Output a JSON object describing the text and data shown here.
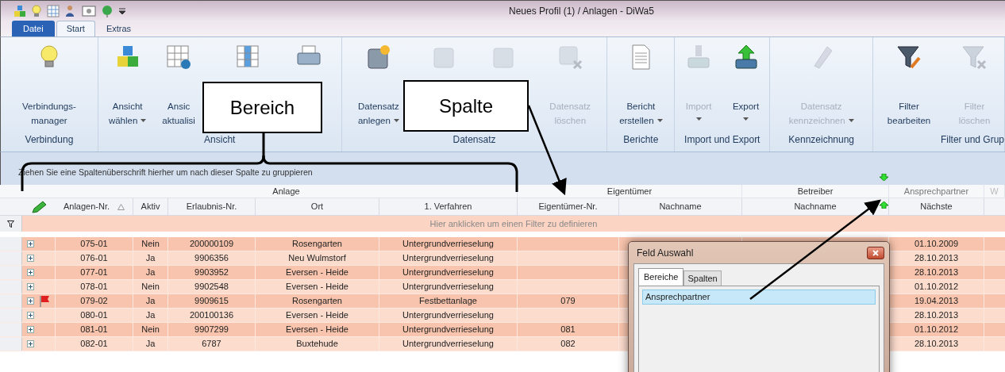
{
  "window": {
    "title": "Neues Profil (1) / Anlagen - DiWa5"
  },
  "tabs": [
    {
      "label": "Datei",
      "kind": "backstage",
      "selected": false
    },
    {
      "label": "Start",
      "kind": "tab",
      "selected": true
    },
    {
      "label": "Extras",
      "kind": "tab",
      "selected": false
    }
  ],
  "ribbon_groups": [
    {
      "label": "Verbindung",
      "buttons": [
        {
          "lines": [
            "Verbindungs-",
            "manager"
          ],
          "dropdown": false,
          "disabled": false
        }
      ]
    },
    {
      "label": "Ansicht",
      "buttons": [
        {
          "lines": [
            "Ansicht",
            "wählen"
          ],
          "dropdown": true,
          "disabled": false
        },
        {
          "lines": [
            "Ansic",
            "aktualisi"
          ],
          "dropdown": false,
          "disabled": false
        },
        {
          "disabled": false
        },
        {
          "disabled": false
        }
      ]
    },
    {
      "label": "Datensatz",
      "buttons": [
        {
          "lines": [
            "Datensatz",
            "anlegen"
          ],
          "dropdown": true,
          "disabled": false
        },
        {
          "disabled": true
        },
        {
          "disabled": true
        },
        {
          "lines": [
            "Datensatz",
            "löschen"
          ],
          "dropdown": false,
          "disabled": true
        }
      ]
    },
    {
      "label": "Berichte",
      "buttons": [
        {
          "lines": [
            "Bericht",
            "erstellen"
          ],
          "dropdown": true,
          "disabled": false
        }
      ]
    },
    {
      "label": "Import und Export",
      "buttons": [
        {
          "lines": [
            "Import"
          ],
          "dropdown": true,
          "disabled": true
        },
        {
          "lines": [
            "Export"
          ],
          "dropdown": true,
          "disabled": false
        }
      ]
    },
    {
      "label": "Kennzeichnung",
      "buttons": [
        {
          "lines": [
            "Datensatz",
            "kennzeichnen"
          ],
          "dropdown": true,
          "disabled": true
        }
      ]
    },
    {
      "label": "Filter und Grup",
      "buttons": [
        {
          "lines": [
            "Filter",
            "bearbeiten"
          ],
          "dropdown": false,
          "disabled": false
        },
        {
          "lines": [
            "Filter",
            "löschen"
          ],
          "dropdown": false,
          "disabled": true
        }
      ]
    }
  ],
  "annotations": [
    {
      "kind": "callout",
      "text": "Bereich"
    },
    {
      "kind": "callout",
      "text": "Spalte"
    }
  ],
  "group_panel": {
    "hint": "Ziehen Sie eine Spaltenüberschrift hierher um nach dieser Spalte zu gruppieren"
  },
  "bands": [
    {
      "label": "Anlage"
    },
    {
      "label": "Eigentümer"
    },
    {
      "label": "Betreiber"
    },
    {
      "label": "Ansprechpartner"
    },
    {
      "label": "W"
    }
  ],
  "columns": [
    {
      "label": "Anlagen-Nr.",
      "sorted": true
    },
    {
      "label": "Aktiv",
      "sorted": false
    },
    {
      "label": "Erlaubnis-Nr.",
      "sorted": false
    },
    {
      "label": "Ort",
      "sorted": false
    },
    {
      "label": "1. Verfahren",
      "sorted": false
    },
    {
      "label": "Eigentümer-Nr.",
      "sorted": false
    },
    {
      "label": "Nachname",
      "sorted": false
    },
    {
      "label": "Nachname",
      "sorted": false
    },
    {
      "label": "Nächste",
      "sorted": false
    }
  ],
  "filter_row": {
    "text": "Hier anklicken um einen Filter zu definieren"
  },
  "rows": [
    {
      "anlagen_nr": "075-01",
      "aktiv": "Nein",
      "erlaubnis_nr": "200000109",
      "ort": "Rosengarten",
      "verfahren": "Untergrundverrieselung",
      "naechste": "01.10.2009",
      "flagged": false
    },
    {
      "anlagen_nr": "076-01",
      "aktiv": "Ja",
      "erlaubnis_nr": "9906356",
      "ort": "Neu Wulmstorf",
      "verfahren": "Untergrundverrieselung",
      "naechste": "28.10.2013",
      "flagged": false
    },
    {
      "anlagen_nr": "077-01",
      "aktiv": "Ja",
      "erlaubnis_nr": "9903952",
      "ort": "Eversen - Heide",
      "verfahren": "Untergrundverrieselung",
      "naechste": "28.10.2013",
      "flagged": false
    },
    {
      "anlagen_nr": "078-01",
      "aktiv": "Nein",
      "erlaubnis_nr": "9902548",
      "ort": "Eversen - Heide",
      "verfahren": "Untergrundverrieselung",
      "naechste": "01.10.2012",
      "flagged": false
    },
    {
      "anlagen_nr": "079-02",
      "aktiv": "Ja",
      "erlaubnis_nr": "9909615",
      "ort": "Rosengarten",
      "verfahren": "Festbettanlage",
      "eigentuemer_nr": "079",
      "naechste": "19.04.2013",
      "flagged": true
    },
    {
      "anlagen_nr": "080-01",
      "aktiv": "Ja",
      "erlaubnis_nr": "200100136",
      "ort": "Eversen - Heide",
      "verfahren": "Untergrundverrieselung",
      "naechste": "28.10.2013",
      "flagged": false
    },
    {
      "anlagen_nr": "081-01",
      "aktiv": "Nein",
      "erlaubnis_nr": "9907299",
      "ort": "Eversen - Heide",
      "verfahren": "Untergrundverrieselung",
      "eigentuemer_nr": "081",
      "naechste": "01.10.2012",
      "flagged": false
    },
    {
      "anlagen_nr": "082-01",
      "aktiv": "Ja",
      "erlaubnis_nr": "6787",
      "ort": "Buxtehude",
      "verfahren": "Untergrundverrieselung",
      "eigentuemer_nr": "082",
      "naechste": "28.10.2013",
      "flagged": false
    }
  ],
  "field_dialog": {
    "title": "Feld Auswahl",
    "tabs": [
      {
        "label": "Bereiche",
        "selected": true
      },
      {
        "label": "Spalten",
        "selected": false
      }
    ],
    "items": [
      {
        "label": "Ansprechpartner",
        "selected": true
      }
    ]
  }
}
